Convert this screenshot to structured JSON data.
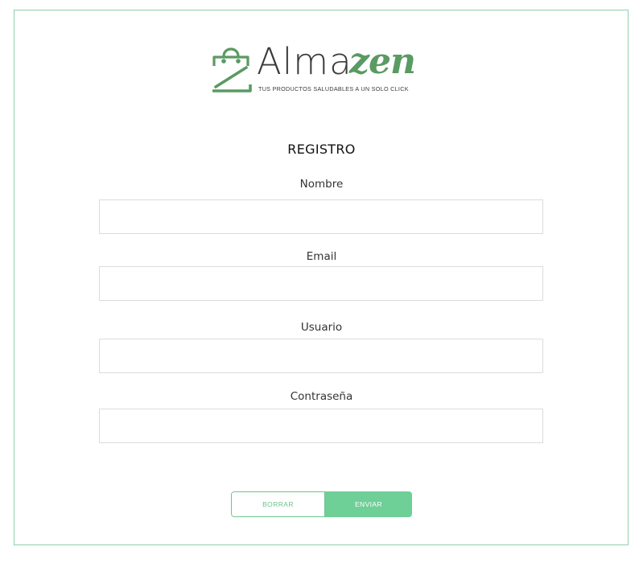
{
  "brand": {
    "name_part1": "Alma",
    "name_part2": "zen",
    "tagline": "TUS PRODUCTOS SALUDABLES A UN SOLO CLICK",
    "colors": {
      "accent": "#5a9a63",
      "border": "#8fd0a8",
      "button": "#6ecf97"
    }
  },
  "form": {
    "title": "REGISTRO",
    "fields": [
      {
        "label": "Nombre",
        "value": ""
      },
      {
        "label": "Email",
        "value": ""
      },
      {
        "label": "Usuario",
        "value": ""
      },
      {
        "label": "Contraseña",
        "value": ""
      }
    ],
    "buttons": {
      "clear": "BORRAR",
      "submit": "ENVIAR"
    }
  },
  "icons": {
    "logo": "shopping-bag-z-icon"
  }
}
